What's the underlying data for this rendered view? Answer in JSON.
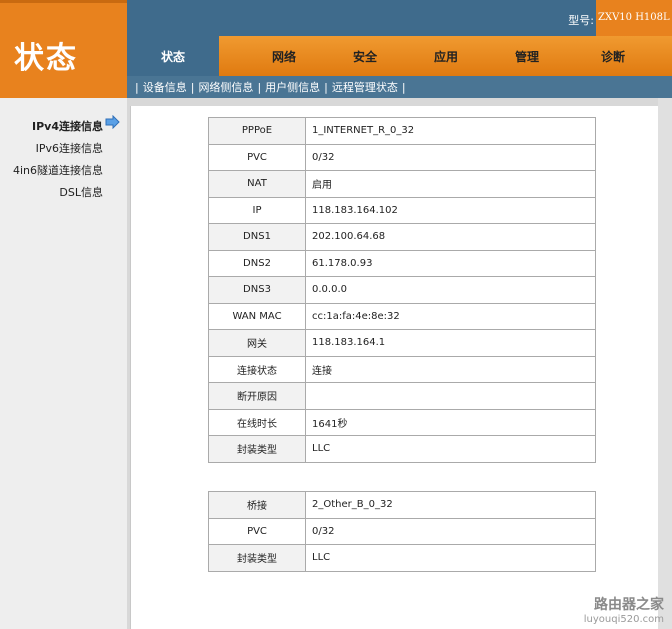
{
  "header": {
    "title": "状态",
    "model_label": "型号:",
    "model_value": "ZXV10 H108L"
  },
  "tabs": [
    {
      "label": "状态",
      "active": true
    },
    {
      "label": "网络"
    },
    {
      "label": "安全"
    },
    {
      "label": "应用"
    },
    {
      "label": "管理"
    },
    {
      "label": "诊断"
    }
  ],
  "subnav": {
    "separator": "|",
    "items": [
      "设备信息",
      "网络侧信息",
      "用户侧信息",
      "远程管理状态"
    ]
  },
  "sidebar": {
    "items": [
      {
        "label": "IPv4连接信息",
        "active": true
      },
      {
        "label": "IPv6连接信息"
      },
      {
        "label": "4in6隧道连接信息"
      },
      {
        "label": "DSL信息"
      }
    ]
  },
  "connection_table": {
    "rows": [
      {
        "key": "PPPoE",
        "value": "1_INTERNET_R_0_32"
      },
      {
        "key": "PVC",
        "value": "0/32"
      },
      {
        "key": "NAT",
        "value": "启用"
      },
      {
        "key": "IP",
        "value": "118.183.164.102"
      },
      {
        "key": "DNS1",
        "value": "202.100.64.68"
      },
      {
        "key": "DNS2",
        "value": "61.178.0.93"
      },
      {
        "key": "DNS3",
        "value": "0.0.0.0"
      },
      {
        "key": "WAN MAC",
        "value": "cc:1a:fa:4e:8e:32"
      },
      {
        "key": "网关",
        "value": "118.183.164.1"
      },
      {
        "key": "连接状态",
        "value": "连接"
      },
      {
        "key": "断开原因",
        "value": ""
      },
      {
        "key": "在线时长",
        "value": "1641秒"
      },
      {
        "key": "封装类型",
        "value": "LLC"
      }
    ]
  },
  "bridge_table": {
    "rows": [
      {
        "key": "桥接",
        "value": "2_Other_B_0_32"
      },
      {
        "key": "PVC",
        "value": "0/32"
      },
      {
        "key": "封装类型",
        "value": "LLC"
      }
    ]
  },
  "watermark": {
    "line1": "路由器之家",
    "line2": "luyouqi520.com"
  },
  "colors": {
    "brand_orange": "#e8821e",
    "header_blue": "#3f6b8c",
    "sidebar_bg": "#eeeeee"
  }
}
